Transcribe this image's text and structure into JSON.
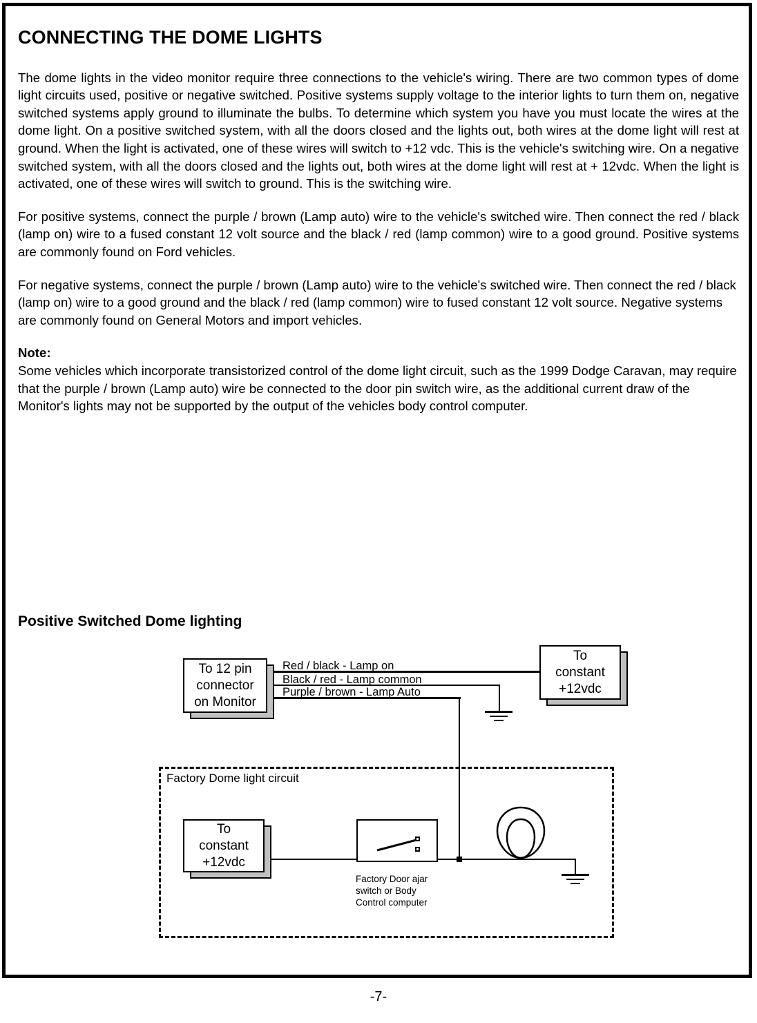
{
  "document": {
    "title": "CONNECTING THE DOME LIGHTS",
    "page_number": "-7-"
  },
  "paragraphs": [
    "The dome lights in the video monitor require three connections to the vehicle's wiring.  There are two common types of dome light circuits used, positive or negative switched.  Positive systems supply voltage to the interior lights to turn them on, negative switched systems apply ground to illuminate the bulbs.  To determine which system you have you must locate the wires at the dome light.  On a positive switched system, with all the doors closed and the lights out, both wires at the dome light will rest at ground.  When the light is activated, one of these wires will switch to +12 vdc.  This is the vehicle's switching wire. On a negative switched system, with all the doors closed and the lights out, both wires at the dome light will rest at + 12vdc.  When the light is activated, one of these wires will switch to ground.  This is the switching wire.",
    "For positive systems, connect the purple / brown (Lamp auto) wire to the vehicle's switched wire.  Then connect the red / black (lamp on) wire to a fused constant 12 volt source and the black / red (lamp common) wire to a good ground.  Positive systems are commonly found on Ford vehicles.",
    "For negative systems, connect the purple / brown (Lamp auto) wire to the vehicle's switched wire.  Then connect the red / black (lamp on) wire to a good ground and the black / red (lamp common) wire to fused constant 12 volt source.  Negative systems are commonly found on General Motors and import vehicles."
  ],
  "note": {
    "label": "Note:",
    "text": "Some vehicles which incorporate transistorized control of the dome light circuit, such as the 1999 Dodge Caravan, may require that the purple / brown (Lamp auto) wire be connected to the door pin switch wire, as the additional current draw of the Monitor's lights may not be supported by the output of the vehicles body control computer."
  },
  "diagram": {
    "title": "Positive Switched Dome lighting",
    "monitor_box": {
      "line1": "To 12 pin",
      "line2": "connector",
      "line3": "on Monitor"
    },
    "constant_box_top": {
      "line1": "To",
      "line2": "constant",
      "line3": "+12vdc"
    },
    "constant_box_bottom": {
      "line1": "To",
      "line2": "constant",
      "line3": "+12vdc"
    },
    "wire_labels": [
      "Red / black - Lamp on",
      "Black / red - Lamp common",
      "Purple / brown - Lamp Auto"
    ],
    "factory_circuit_label": "Factory Dome light circuit",
    "switch_caption": [
      "Factory Door ajar",
      "switch  or  Body",
      "Control  computer"
    ]
  },
  "colors": {
    "ink": "#000000",
    "paper": "#ffffff",
    "box_shadow": "#c0c0c0"
  }
}
